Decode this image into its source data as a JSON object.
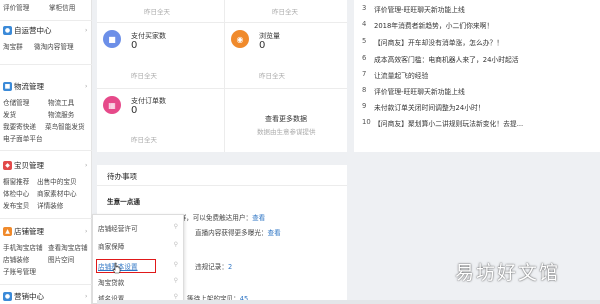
{
  "sidebar": {
    "top_links": [
      "评价管理",
      "掌柜信用"
    ],
    "sections": [
      {
        "title": "自运营中心",
        "color": "#3b8ad8",
        "links": [
          "淘宝群",
          "微淘内容管理"
        ]
      },
      {
        "title": "物流管理",
        "color": "#3b8ad8",
        "links": [
          "仓储管理",
          "物流工具",
          "发货",
          "物流服务",
          "我要寄快递",
          "菜鸟智能发货",
          "电子面单平台"
        ]
      },
      {
        "title": "宝贝管理",
        "color": "#e24a4a",
        "links": [
          "橱窗推荐",
          "出售中的宝贝",
          "体检中心",
          "商家素材中心",
          "发布宝贝",
          "详情装修"
        ]
      },
      {
        "title": "店铺管理",
        "color": "#f08a2b",
        "links": [
          "手机淘宝店铺",
          "查看淘宝店铺",
          "店铺装修",
          "图片空间",
          "子账号管理"
        ]
      },
      {
        "title": "营销中心",
        "color": "#3b8ad8",
        "links": []
      }
    ]
  },
  "stats": {
    "cell1_sub": "昨日全天",
    "cell2_sub": "昨日全天",
    "pay_buyers_label": "支付买家数",
    "pay_buyers_value": "0",
    "pay_buyers_sub": "昨日全天",
    "views_label": "浏览量",
    "views_value": "0",
    "views_sub": "昨日全天",
    "orders_label": "支付订单数",
    "orders_value": "0",
    "orders_sub": "昨日全天",
    "more_link": "查看更多数据",
    "more_note": "数据由生意参谋提供"
  },
  "news": [
    {
      "idx": "3",
      "text": "评价管理-旺旺聊天新功能上线"
    },
    {
      "idx": "4",
      "text": "2018年消费者新趋势，小二们你来啊！"
    },
    {
      "idx": "5",
      "text": "【问商友】开车却没有消单涨，怎么办？！"
    },
    {
      "idx": "6",
      "text": "成本高效客门槛：电商机器人来了，24小时起活"
    },
    {
      "idx": "7",
      "text": "让流量起飞的经验"
    },
    {
      "idx": "8",
      "text": "评价管理-旺旺聊天新功能上线"
    },
    {
      "idx": "9",
      "text": "未付款订单关闭时间调整为24小时！"
    },
    {
      "idx": "10",
      "text": "【问商友】聚划算小二讲规则玩法新变化！去提..."
    }
  ],
  "todo": {
    "title": "待办事项",
    "heading": "生意一点通",
    "line1_pre": "小小二提示你已通过淘宝群，可以免费触达用户：",
    "line1_link": "查看",
    "line2_pre": "直播内容获得更多曝光：",
    "line2_link": "查看",
    "line3_pre": "违规记录：",
    "line3_value": "2",
    "line4_pre": "等待上架的宝贝：",
    "line4_value": "45"
  },
  "flyout": {
    "items": [
      "店铺经营许可",
      "商家保障",
      "店铺基本设置",
      "淘宝贷款",
      "域名设置"
    ]
  },
  "watermark": "易坊好文馆"
}
